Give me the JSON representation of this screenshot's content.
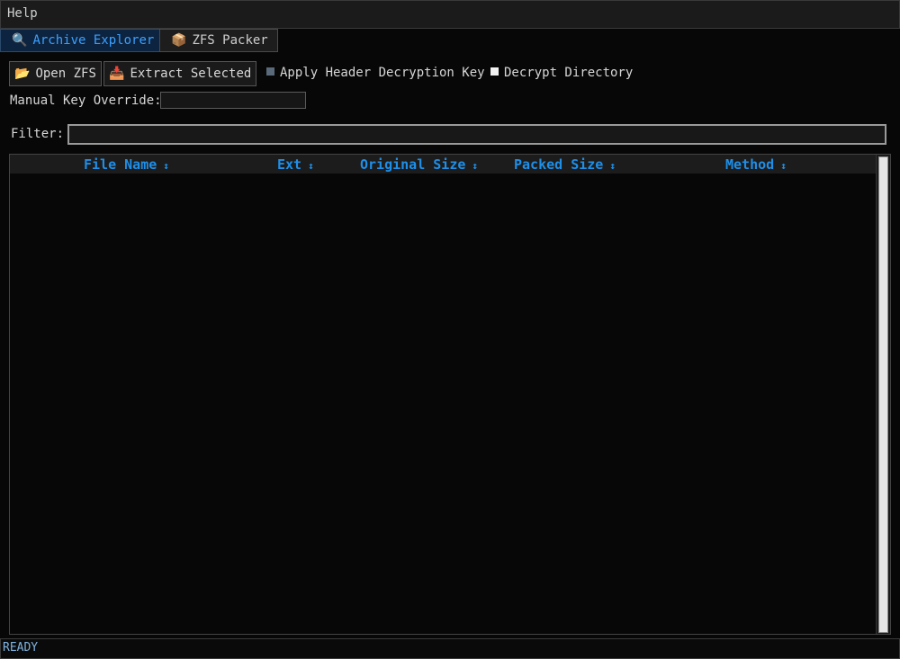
{
  "menubar": {
    "items": [
      {
        "label": "Help"
      }
    ]
  },
  "tabs": [
    {
      "label": "Archive Explorer",
      "icon": "🔍",
      "icon_name": "search-icon",
      "active": true
    },
    {
      "label": "ZFS Packer",
      "icon": "📦",
      "icon_name": "package-icon",
      "active": false
    }
  ],
  "toolbar": {
    "open_label": "Open ZFS",
    "open_icon": "📂",
    "extract_label": "Extract Selected",
    "extract_icon": "📥",
    "apply_header_label": "Apply Header Decryption Key",
    "apply_header_checked": true,
    "decrypt_directory_label": "Decrypt Directory",
    "decrypt_directory_checked": false
  },
  "key_override": {
    "label": "Manual Key Override:",
    "value": ""
  },
  "filter": {
    "label": "Filter:",
    "value": ""
  },
  "table": {
    "columns": [
      {
        "label": "File Name",
        "sort_icon": "↕"
      },
      {
        "label": "Ext",
        "sort_icon": "↕"
      },
      {
        "label": "Original Size",
        "sort_icon": "↕"
      },
      {
        "label": "Packed Size",
        "sort_icon": "↕"
      },
      {
        "label": "Method",
        "sort_icon": "↕"
      }
    ],
    "rows": []
  },
  "status": {
    "text": "READY"
  },
  "colors": {
    "accent": "#1e8fe8",
    "active_tab_bg": "#0d2440",
    "background": "#070707",
    "status_text": "#7fb3e0"
  }
}
